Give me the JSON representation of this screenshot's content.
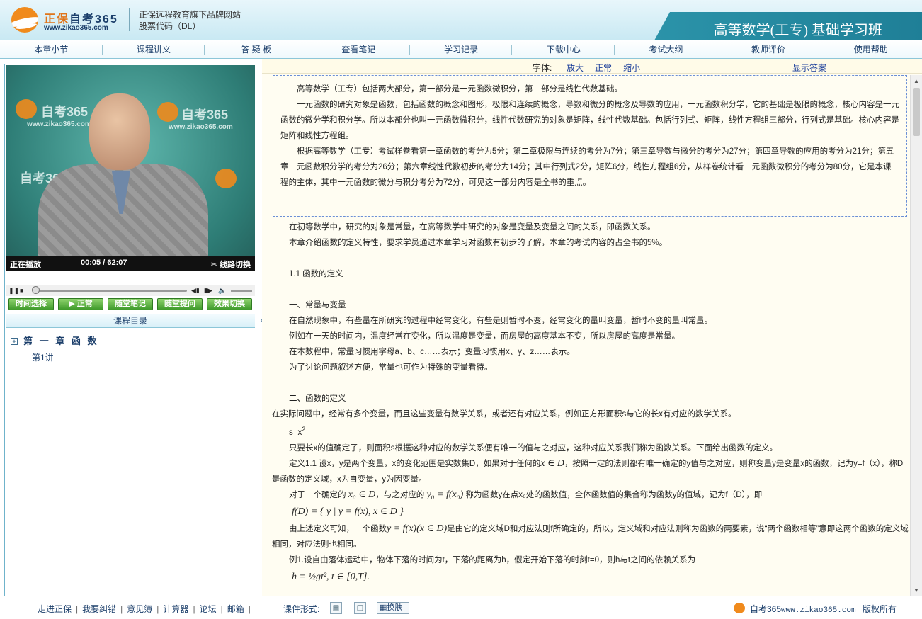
{
  "header": {
    "brand_a": "正保",
    "brand_b": "自考365",
    "brand_url": "www.zikao365.com",
    "tagline1": "正保远程教育旗下品牌网站",
    "tagline2": "股票代码（DL）",
    "course_title": "高等数学(工专) 基础学习班"
  },
  "nav": [
    "本章小节",
    "课程讲义",
    "答 疑 板",
    "查看笔记",
    "学习记录",
    "下载中心",
    "考试大纲",
    "教师评价",
    "使用帮助"
  ],
  "video": {
    "watermark": "自考365",
    "watermark_url": "www.zikao365.com",
    "status": "正在播放",
    "time_current": "00:05",
    "time_sep": "/",
    "time_total": "62:07",
    "switch_label": "线路切换",
    "progress_fraction": 0.01
  },
  "player_buttons": [
    "时间选择",
    "▶ 正常",
    "随堂笔记",
    "随堂提问",
    "效果切换"
  ],
  "toc": {
    "title": "课程目录",
    "chapter": "第 一 章 函 数",
    "lesson": "第1讲"
  },
  "font_bar": {
    "label": "字体:",
    "larger": "放大",
    "normal": "正常",
    "smaller": "缩小",
    "show_answer": "显示答案"
  },
  "summary": [
    "高等数学（工专）包括两大部分，第一部分是一元函数微积分，第二部分是线性代数基础。",
    "一元函数的研究对象是函数，包括函数的概念和图形，极限和连续的概念，导数和微分的概念及导数的应用，一元函数积分学，它的基础是极限的概念，核心内容是一元函数的微分学和积分学。所以本部分也叫一元函数微积分，线性代数研究的对象是矩阵，线性代数基础。包括行列式、矩阵，线性方程组三部分，行列式是基础。核心内容是矩阵和线性方程组。",
    "根据高等数学（工专）考试样卷看第一章函数的考分为5分；第二章极限与连续的考分为7分；第三章导数与微分的考分为27分；第四章导数的应用的考分为21分；第五章一元函数积分学的考分为26分；第六章线性代数初步的考分为14分；其中行列式2分，矩阵6分，线性方程组6分，从样卷统计看一元函数微积分的考分为80分，它是本课程的主体，其中一元函数的微分与积分考分为72分，可见这一部分内容是全书的重点。"
  ],
  "body": {
    "p1": "在初等数学中，研究的对象是常量，在高等数学中研究的对象是变量及变量之间的关系，即函数关系。",
    "p2": "本章介绍函数的定义特性，要求学员通过本章学习对函数有初步的了解，本章的考试内容的占全书的5%。",
    "s11": "1.1 函数的定义",
    "h1": "一、常量与变量",
    "p3": "在自然现象中，有些量在所研究的过程中经常变化，有些是则暂时不变，经常变化的量叫变量，暂时不变的量叫常量。",
    "p4": "例如在一天的时间内，温度经常在变化，所以温度是变量，而房屋的高度基本不变，所以房屋的高度是常量。",
    "p5": "在本数程中，常量习惯用字母a、b、c……表示；变量习惯用x、y、z……表示。",
    "p6": "为了讨论问题叙述方便，常量也可作为特殊的变量看待。",
    "h2": "二、函数的定义",
    "p7": "在实际问题中，经常有多个变量，而且这些变量有数学关系，或者还有对应关系，例如正方形面积s与它的长x有对应的数学关系。",
    "formula1_base": "s=x",
    "formula1_exp": "2",
    "p8": "只要长x的值确定了，则面积s根据这种对应的数学关系便有唯一的值与之对应，这种对应关系我们称为函数关系。下面给出函数的定义。",
    "def_a": "定义1.1 设x，y是两个变量，x的变化范围是实数集D，如果对于任何的",
    "def_math": "x ∈ D",
    "def_b": "，按照一定的法则都有唯一确定的y值与之对应，则称变量y是变量x的函数，记为y=f（x），称D是函数的定义域，x为自变量，y为因变量。",
    "p9a": "对于一个确定的",
    "p9m1": "x₀ ∈ D",
    "p9b": "，与之对应的",
    "p9m2": "y₀ = f(x₀)",
    "p9c": "称为函数y在点x₀处的函数值，全体函数值的集合称为函数y的值域，记为f（D），即",
    "formula2": "f(D) = { y | y = f(x), x ∈ D }",
    "p10a": "由上述定义可知，一个函数",
    "p10m": "y = f(x)(x ∈ D)",
    "p10b": "是由它的定义域D和对应法则f所确定的，所以，定义域和对应法则称为函数的两要素，说“两个函数相等”意即这两个函数的定义域相同，对应法则也相同。",
    "p11": "例1.设自由落体运动中，物体下落的时间为t，下落的距离为h，假定开始下落的时刻t=0，则h与t之间的依赖关系为",
    "formula3": "h = ½gt², t ∈ [0,T]."
  },
  "footer": {
    "links": [
      "走进正保",
      "我要纠错",
      "意见簿",
      "计算器",
      "论坛",
      "邮箱"
    ],
    "courseware_label": "课件形式:",
    "skin": "换肤",
    "site_name": "自考365",
    "site_url": "www.zikao365.com",
    "copyright": "版权所有"
  }
}
